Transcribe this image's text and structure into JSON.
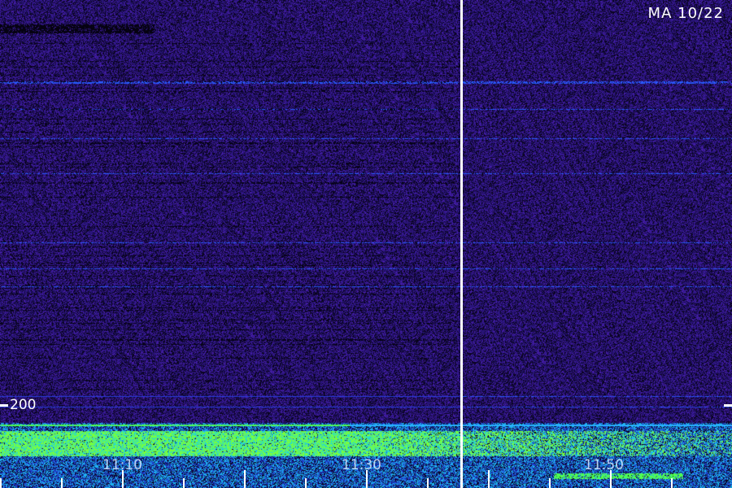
{
  "header": {
    "station_label": "MA 10/22"
  },
  "frequency_axis": {
    "marker_label": "200"
  },
  "time_axis": {
    "labels": [
      "11:10",
      "11:30",
      "11:50"
    ]
  },
  "colors": {
    "background": "#1a0a4a",
    "noise_dark": "#0a0420",
    "noise_mid": "#3a1a8a",
    "band_blue": "#3060ff",
    "low_freq_green": "#40ff40",
    "low_freq_cyan": "#20c0ff",
    "axis_white": "#ffffff"
  }
}
